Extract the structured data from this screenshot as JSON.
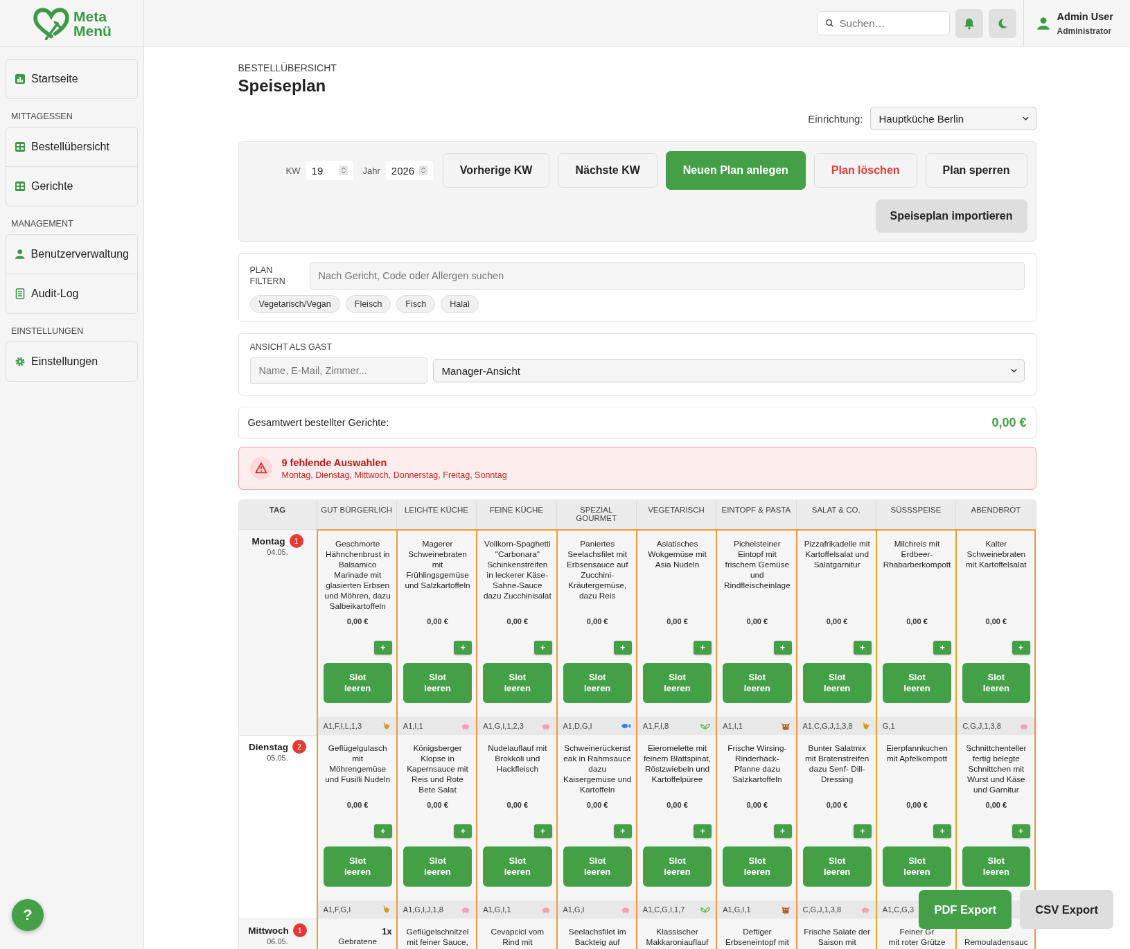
{
  "logo": {
    "line1": "Meta",
    "line2": "Menü"
  },
  "header": {
    "search_placeholder": "Suchen…",
    "user": {
      "name": "Admin User",
      "role": "Administrator"
    }
  },
  "sidebar": {
    "sections": [
      {
        "items": [
          {
            "label": "Startseite",
            "kind": "chart"
          }
        ]
      },
      {
        "title": "MITTAGESSEN",
        "items": [
          {
            "label": "Bestellübersicht",
            "kind": "grid"
          },
          {
            "label": "Gerichte",
            "kind": "grid"
          }
        ]
      },
      {
        "title": "MANAGEMENT",
        "items": [
          {
            "label": "Benutzerverwaltung",
            "kind": "person"
          },
          {
            "label": "Audit-Log",
            "kind": "doc"
          }
        ]
      },
      {
        "title": "EINSTELLUNGEN",
        "items": [
          {
            "label": "Einstellungen",
            "kind": "gear"
          }
        ]
      }
    ]
  },
  "page": {
    "breadcrumb": "BESTELLÜBERSICHT",
    "title": "Speiseplan",
    "facility_label": "Einrichtung:",
    "facility": "Hauptküche Berlin"
  },
  "toolbar": {
    "week_label": "KW",
    "week": "19",
    "year_label": "Jahr",
    "year": "2026",
    "buttons": [
      {
        "label": "Vorherige KW",
        "kind": "default"
      },
      {
        "label": "Nächste KW",
        "kind": "default"
      },
      {
        "label": "Neuen Plan anlegen",
        "kind": "primary"
      },
      {
        "label": "Plan löschen",
        "kind": "danger"
      },
      {
        "label": "Plan sperren",
        "kind": "default"
      },
      {
        "label": "Speiseplan importieren",
        "kind": "muted"
      }
    ]
  },
  "filter": {
    "label": "PLAN FILTERN",
    "placeholder": "Nach Gericht, Code oder Allergen suchen",
    "chips": [
      "Vegetarisch/Vegan",
      "Fleisch",
      "Fisch",
      "Halal"
    ]
  },
  "guest_view": {
    "label": "ANSICHT ALS GAST",
    "placeholder": "Name, E-Mail, Zimmer...",
    "view": "Manager-Ansicht"
  },
  "total": {
    "label": "Gesamtwert bestellter Gerichte:",
    "value": "0,00 €"
  },
  "alert": {
    "title": "9 fehlende Auswahlen",
    "days": "Montag, Dienstag, Mittwoch, Donnerstag, Freitag, Sonntag"
  },
  "table": {
    "day_header": "TAG",
    "columns": [
      "GUT BÜRGERLICH",
      "LEICHTE KÜCHE",
      "FEINE KÜCHE",
      "SPEZIAL GOURMET",
      "VEGETARISCH",
      "EINTOPF & PASTA",
      "SALAT & CO.",
      "SÜSSSPEISE",
      "ABENDBROT"
    ],
    "rows": [
      {
        "day": "Montag",
        "date": "04.05.",
        "badge": "1",
        "cells": [
          {
            "dish": "Geschmorte Hähnchenbrust in Balsamico Marinade mit glasierten Erbsen und Möhren, dazu Salbeikartoffeln",
            "price": "0,00 €",
            "add": "+",
            "clear": "Slot leeren",
            "allergens": "A1,F,I,L,1,3",
            "kind": "chicken"
          },
          {
            "dish": "Magerer Schweinebraten mit Frühlingsgemüse und Salzkartoffeln",
            "price": "0,00 €",
            "add": "+",
            "clear": "Slot leeren",
            "allergens": "A1,I,1",
            "kind": "pig"
          },
          {
            "dish": "Vollkorn-Spaghetti \"Carbonara\" Schinkenstreifen in leckerer Käse-Sahne-Sauce dazu Zucchinisalat",
            "price": "0,00 €",
            "add": "+",
            "clear": "Slot leeren",
            "allergens": "A1,G,I,1,2,3",
            "kind": "pig"
          },
          {
            "dish": "Paniertes Seelachsfilet mit Erbsensauce auf Zucchini-Kräutergemüse, dazu Reis",
            "price": "0,00 €",
            "add": "+",
            "clear": "Slot leeren",
            "allergens": "A1,D,G,I",
            "kind": "fish"
          },
          {
            "dish": "Asiatisches Wokgemüse mit Asia Nudeln",
            "price": "0,00 €",
            "add": "+",
            "clear": "Slot leeren",
            "allergens": "A1,F,I,8",
            "kind": "leaf"
          },
          {
            "dish": "Pichelsteiner Eintopf mit frischem Gemüse und Rindfleischeinlage",
            "price": "0,00 €",
            "add": "+",
            "clear": "Slot leeren",
            "allergens": "A1,I,1",
            "kind": "cow"
          },
          {
            "dish": "Pizzafrikadelle mit Kartoffelsalat und Salatgarnitur",
            "price": "0,00 €",
            "add": "+",
            "clear": "Slot leeren",
            "allergens": "A1,C,G,J,1,3,8",
            "kind": "chicken"
          },
          {
            "dish": "Milchreis mit Erdbeer-Rhabarberkompott",
            "price": "0,00 €",
            "add": "+",
            "clear": "Slot leeren",
            "allergens": "G,1"
          },
          {
            "dish": "Kalter Schweinebraten mit Kartoffelsalat",
            "price": "0,00 €",
            "add": "+",
            "clear": "Slot leeren",
            "allergens": "C,G,J,1,3,8",
            "kind": "pig"
          }
        ]
      },
      {
        "day": "Dienstag",
        "date": "05.05.",
        "badge": "2",
        "cells": [
          {
            "dish": "Geflügelgulasch mit Möhrengemüse und Fusilli Nudeln",
            "price": "0,00 €",
            "add": "+",
            "clear": "Slot leeren",
            "allergens": "A1,F,G,I",
            "kind": "chicken"
          },
          {
            "dish": "Königsberger Klopse in Kapernsauce mit Reis und Rote Bete Salat",
            "price": "0,00 €",
            "add": "+",
            "clear": "Slot leeren",
            "allergens": "A1,G,I,J,1,8",
            "kind": "pig"
          },
          {
            "dish": "Nudelauflauf mit Brokkoli und Hackfleisch",
            "price": "0,00 €",
            "add": "+",
            "clear": "Slot leeren",
            "allergens": "A1,G,I,1",
            "kind": "pig"
          },
          {
            "dish": "Schweinerückensteak in Rahmsauce dazu Kaisergemüse und Kartoffeln",
            "price": "0,00 €",
            "add": "+",
            "clear": "Slot leeren",
            "allergens": "A1,G,I",
            "kind": "pig"
          },
          {
            "dish": "Eieromelette mit feinem Blattspinat, Röstzwiebeln und Kartoffelpüree",
            "price": "0,00 €",
            "add": "+",
            "clear": "Slot leeren",
            "allergens": "A1,C,G,I,1,7",
            "kind": "leaf"
          },
          {
            "dish": "Frische Wirsing-Rinderhack-Pfanne dazu Salzkartoffeln",
            "price": "0,00 €",
            "add": "+",
            "clear": "Slot leeren",
            "allergens": "A1,G,I,1",
            "kind": "cow"
          },
          {
            "dish": "Bunter Salatmix mit Bratenstreifen dazu Senf- Dill-Dressing",
            "price": "0,00 €",
            "add": "+",
            "clear": "Slot leeren",
            "allergens": "C,G,J,1,3,8",
            "kind": "pig"
          },
          {
            "dish": "Eierpfannkuchen mit Apfelkompott",
            "price": "0,00 €",
            "add": "+",
            "clear": "Slot leeren",
            "allergens": "A1,C,G,3"
          },
          {
            "dish": "Schnittchenteller fertig belegte Schnittchen mit Wurst und Käse und Garnitur",
            "price": "0,00 €",
            "add": "+",
            "clear": "Slot leeren"
          }
        ]
      },
      {
        "day": "Mittwoch",
        "date": "06.05.",
        "badge": "1",
        "cells": [
          {
            "quantity": "1x",
            "dish": "Gebratene"
          },
          {
            "dish": "Geflügelschnitzel\nmit feiner Sauce,"
          },
          {
            "dish": "Cevapcici vom\nRind mit"
          },
          {
            "dish": "Seelachsfilet im\nBackteig auf"
          },
          {
            "dish": "Klassischer\nMakkaroniauflauf"
          },
          {
            "dish": "Deftiger\nErbseneintopf mit"
          },
          {
            "dish": "Frische Salate der\nSaison mit"
          },
          {
            "dish": "Feiner Gr\nmit roter Grütze"
          },
          {
            "dish": "\nRemouladensauc"
          }
        ]
      }
    ]
  },
  "help": "?",
  "exports": [
    {
      "label": "PDF Export",
      "kind": "primary"
    },
    {
      "label": "CSV Export",
      "kind": "muted"
    }
  ]
}
